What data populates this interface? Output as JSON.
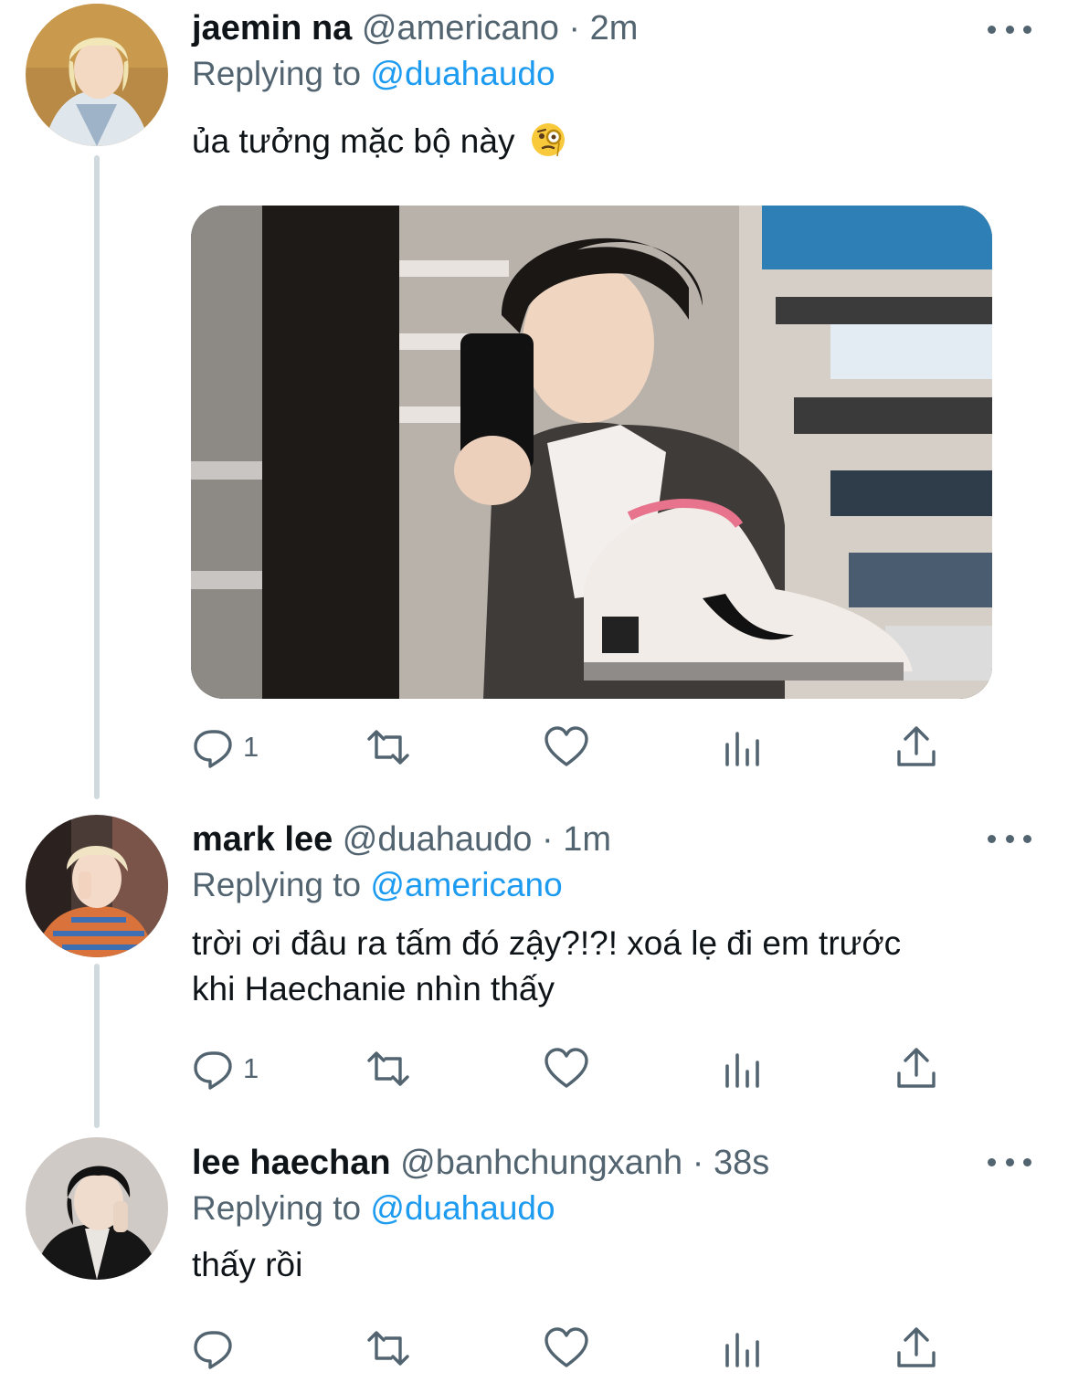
{
  "colors": {
    "link": "#1d9bf0",
    "secondary_text": "#536471",
    "primary_text": "#0f1419",
    "thread_line": "#cfd9de"
  },
  "tweets": [
    {
      "name": "jaemin na",
      "handle": "@americano",
      "separator": "·",
      "time": "2m",
      "replying_prefix": "Replying to",
      "replying_to": "@duahaudo",
      "text": "ủa tưởng mặc bộ này",
      "emoji": "face-with-monocle-emoji",
      "has_media": true,
      "reply_count": "1"
    },
    {
      "name": "mark lee",
      "handle": "@duahaudo",
      "separator": "·",
      "time": "1m",
      "replying_prefix": "Replying to",
      "replying_to": "@americano",
      "text_line1": "trời ơi đâu ra tấm đó zậy?!?! xoá lẹ đi em trước",
      "text_line2": "khi Haechanie nhìn thấy",
      "reply_count": "1"
    },
    {
      "name": "lee haechan",
      "handle": "@banhchungxanh",
      "separator": "·",
      "time": "38s",
      "replying_prefix": "Replying to",
      "replying_to": "@duahaudo",
      "text": "thấy rồi",
      "reply_count": ""
    }
  ],
  "icons": {
    "reply": "reply-icon",
    "retweet": "retweet-icon",
    "like": "heart-icon",
    "stats": "analytics-icon",
    "share": "share-icon",
    "more": "more-icon"
  }
}
